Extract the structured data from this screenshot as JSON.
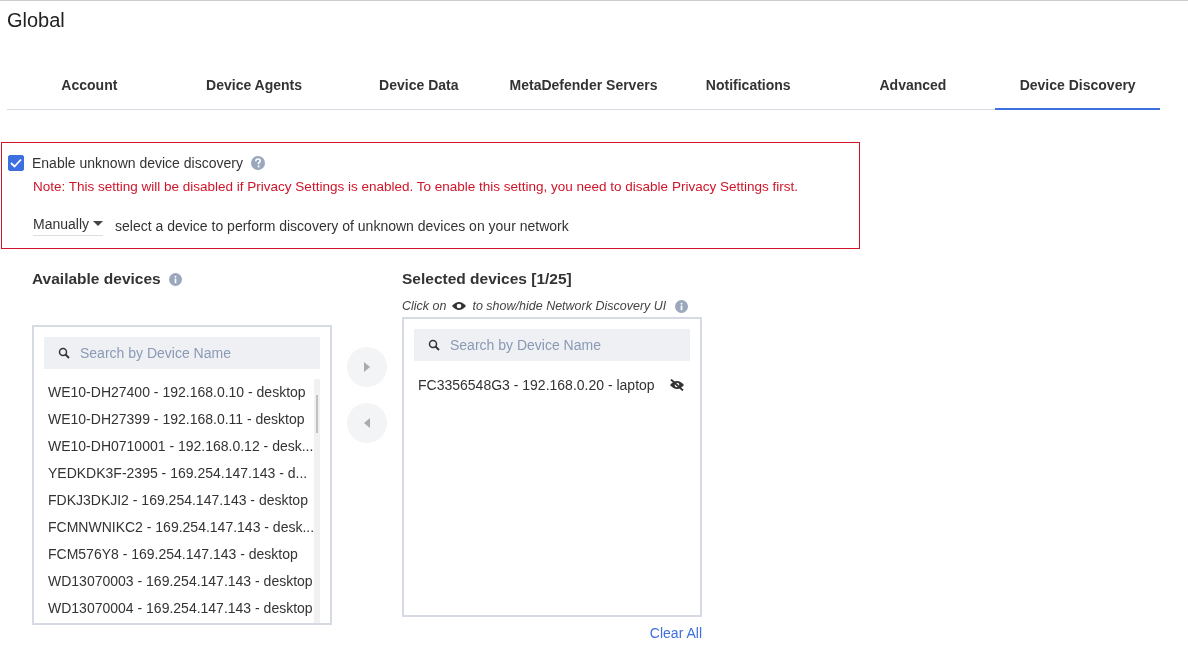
{
  "page_title": "Global",
  "tabs": [
    {
      "label": "Account",
      "selected": false
    },
    {
      "label": "Device Agents",
      "selected": false
    },
    {
      "label": "Device Data",
      "selected": false
    },
    {
      "label": "MetaDefender Servers",
      "selected": false
    },
    {
      "label": "Notifications",
      "selected": false
    },
    {
      "label": "Advanced",
      "selected": false
    },
    {
      "label": "Device Discovery",
      "selected": true
    }
  ],
  "discovery": {
    "enable_label": "Enable unknown device discovery",
    "checked": true,
    "note": "Note: This setting will be disabled if Privacy Settings is enabled. To enable this setting, you need to disable Privacy Settings first.",
    "mode": "Manually",
    "mode_description": "select a device to perform discovery of unknown devices on your network"
  },
  "available": {
    "title": "Available devices",
    "search_placeholder": "Search by Device Name",
    "items": [
      "WE10-DH27400 - 192.168.0.10 - desktop",
      "WE10-DH27399 - 192.168.0.11 - desktop",
      "WE10-DH0710001 - 192.168.0.12 - desk...",
      "YEDKDK3F-2395 - 169.254.147.143 - d...",
      "FDKJ3DKJI2 - 169.254.147.143 - desktop",
      "FCMNWNIKC2 - 169.254.147.143 - desk...",
      "FCM576Y8 - 169.254.147.143 - desktop",
      "WD13070003 - 169.254.147.143 - desktop",
      "WD13070004 - 169.254.147.143 - desktop"
    ]
  },
  "selected": {
    "title": "Selected devices [1/25]",
    "hint_before": "Click on",
    "hint_after": "to show/hide Network Discovery UI",
    "search_placeholder": "Search by Device Name",
    "items": [
      {
        "label": "FC3356548G3 - 192.168.0.20 - laptop",
        "ui_visible": false
      }
    ],
    "clear_label": "Clear All"
  }
}
